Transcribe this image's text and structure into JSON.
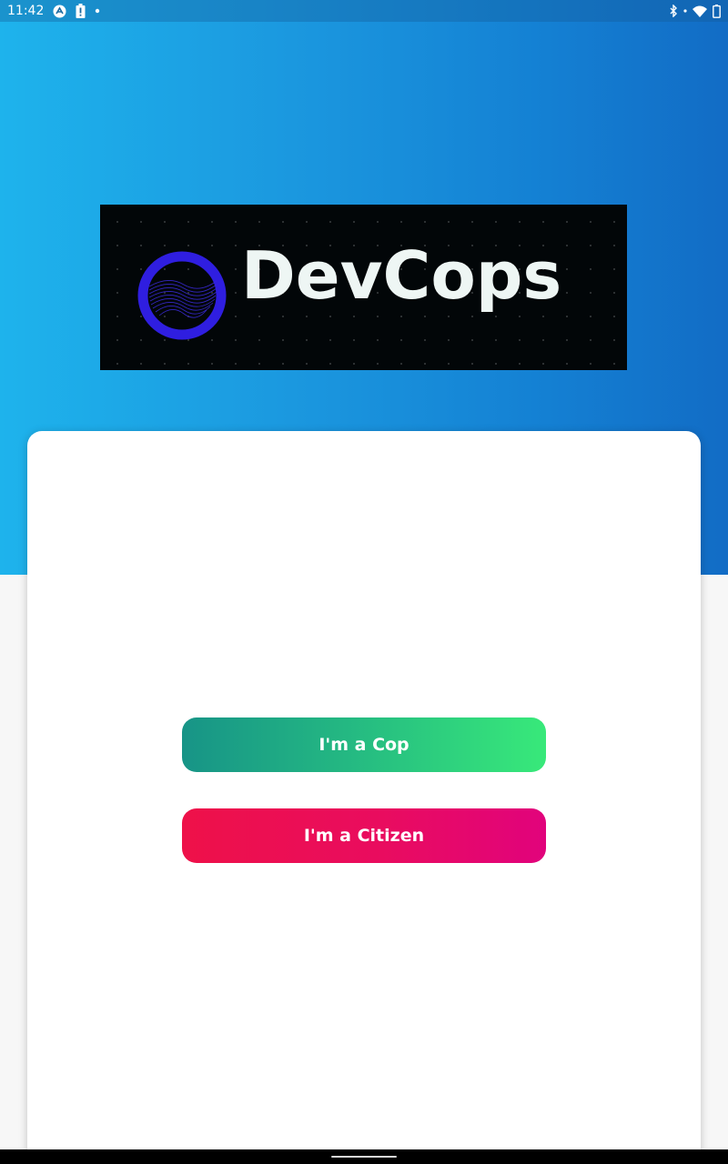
{
  "status_bar": {
    "time": "11:42",
    "left_icons": [
      "app-notification-icon",
      "battery-alert-icon",
      "dot-icon"
    ],
    "right_icons": [
      "bluetooth-icon",
      "wifi-icon",
      "battery-icon"
    ]
  },
  "logo": {
    "text": "DevCops",
    "mark_icon": "devcops-ring-logo-icon",
    "colors": {
      "banner_bg": "#020608",
      "ring": "#2f1ee0",
      "text": "#eef6f4"
    }
  },
  "actions": {
    "cop_label": "I'm a Cop",
    "citizen_label": "I'm a Citizen"
  },
  "colors": {
    "hero_gradient_start": "#1eb3ec",
    "hero_gradient_end": "#126cc5",
    "cop_gradient_start": "#179487",
    "cop_gradient_end": "#38e97a",
    "citizen_gradient_start": "#ee1149",
    "citizen_gradient_end": "#e1037c",
    "card_bg": "#ffffff",
    "page_bg": "#f7f7f7"
  }
}
